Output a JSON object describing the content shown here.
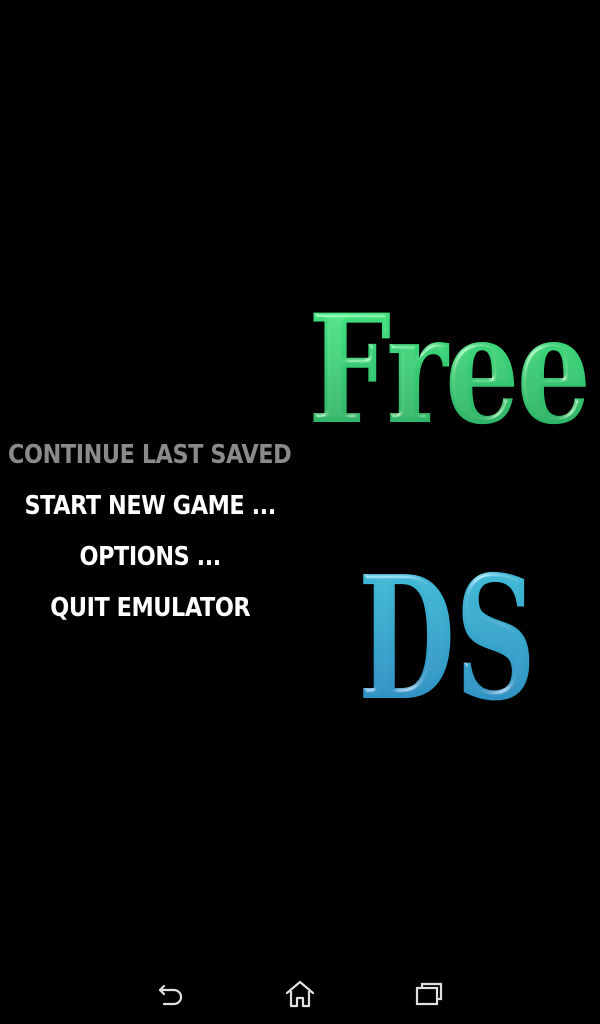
{
  "menu": {
    "items": [
      {
        "label": "CONTINUE LAST SAVED",
        "enabled": false
      },
      {
        "label": "START NEW GAME ...",
        "enabled": true
      },
      {
        "label": "OPTIONS ...",
        "enabled": true
      },
      {
        "label": "QUIT EMULATOR",
        "enabled": true
      }
    ]
  },
  "logo": {
    "line1": "Free",
    "line2": "DS",
    "line1_color_top": "#3ee07a",
    "line1_color_bottom": "#2fb86a",
    "line2_color_top": "#3ab8d0",
    "line2_color_bottom": "#2a8fc0"
  },
  "navbar": {
    "back_icon": "back-icon",
    "home_icon": "home-icon",
    "recent_icon": "recent-apps-icon"
  },
  "colors": {
    "background": "#000000",
    "menu_text": "#ffffff",
    "menu_disabled": "#8a8a8a",
    "nav_icon": "#e0e0e0"
  }
}
